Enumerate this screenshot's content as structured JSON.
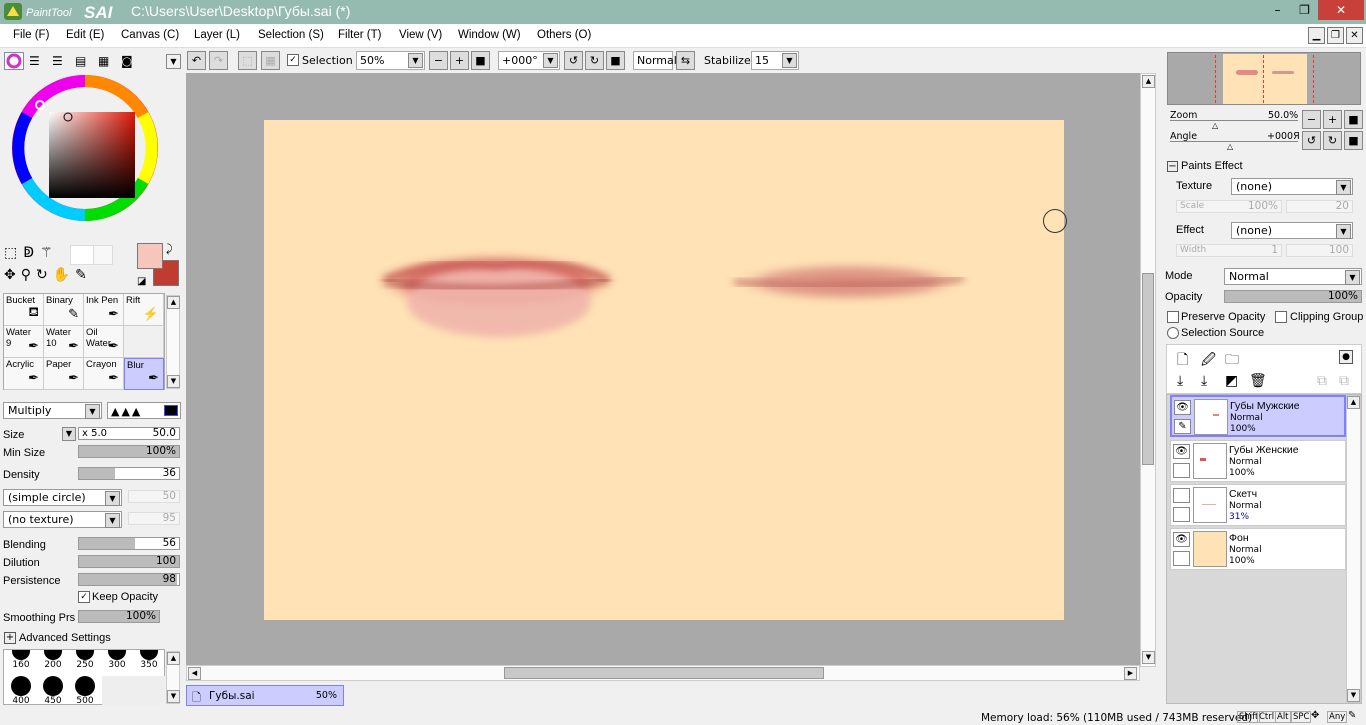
{
  "app": {
    "logo_text": "PaintTool SAI",
    "title": "C:\\Users\\User\\Desktop\\Губы.sai (*)"
  },
  "window": {
    "minimize": "–",
    "maximize": "❐",
    "close": "✕"
  },
  "menu": [
    "File (F)",
    "Edit (E)",
    "Canvas (C)",
    "Layer (L)",
    "Selection (S)",
    "Filter (T)",
    "View (V)",
    "Window (W)",
    "Others (O)"
  ],
  "toolbar": {
    "selection_label": "Selection",
    "selection_checked": true,
    "zoom": "50%",
    "angle": "+000°",
    "blend": "Normal",
    "stabilizer_label": "Stabilizer",
    "stabilizer": "15"
  },
  "tools": [
    {
      "name": "Bucket",
      "num": ""
    },
    {
      "name": "Binary",
      "num": ""
    },
    {
      "name": "Ink Pen",
      "num": ""
    },
    {
      "name": "Rift",
      "num": ""
    },
    {
      "name": "Water",
      "num": "9"
    },
    {
      "name": "Water",
      "num": "10"
    },
    {
      "name": "Oil Water",
      "num": ""
    },
    {
      "name": "",
      "num": ""
    },
    {
      "name": "Acrylic",
      "num": ""
    },
    {
      "name": "Paper",
      "num": ""
    },
    {
      "name": "Crayon",
      "num": ""
    },
    {
      "name": "Blur",
      "num": ""
    }
  ],
  "brush": {
    "mode": "Multiply",
    "size_label": "Size",
    "size_mult": "x 5.0",
    "size": "50.0",
    "min_size_label": "Min Size",
    "min_size": "100%",
    "min_size_frac": 1.0,
    "density_label": "Density",
    "density": "36",
    "density_frac": 0.36,
    "shape": "(simple circle)",
    "shape_val": "50",
    "texture": "(no texture)",
    "texture_val": "95",
    "blending_label": "Blending",
    "blending": "56",
    "blending_frac": 0.56,
    "dilution_label": "Dilution",
    "dilution": "100",
    "dilution_frac": 1.0,
    "persistence_label": "Persistence",
    "persistence": "98",
    "persistence_frac": 0.98,
    "keep_opacity_label": "Keep Opacity",
    "smoothing_label": "Smoothing Prs",
    "smoothing": "100%",
    "smoothing_frac": 1.0,
    "advanced_label": "Advanced Settings",
    "sizes": [
      "160",
      "200",
      "250",
      "300",
      "350",
      "400",
      "450",
      "500"
    ]
  },
  "navigator": {
    "zoom_label": "Zoom",
    "zoom": "50.0%",
    "angle_label": "Angle",
    "angle": "+000Я"
  },
  "paints_effect": {
    "header": "Paints Effect",
    "texture_label": "Texture",
    "texture": "(none)",
    "scale_label": "Scale",
    "scale": "100%",
    "scale2": "20",
    "effect_label": "Effect",
    "effect": "(none)",
    "width_label": "Width",
    "width": "1",
    "width2": "100"
  },
  "layer_props": {
    "mode_label": "Mode",
    "mode": "Normal",
    "opacity_label": "Opacity",
    "opacity": "100%",
    "preserve": "Preserve Opacity",
    "clipping": "Clipping Group",
    "selsource": "Selection Source"
  },
  "layers": [
    {
      "name": "Губы Мужские",
      "mode": "Normal",
      "opacity": "100%",
      "visible": true,
      "selected": true
    },
    {
      "name": "Губы Женские",
      "mode": "Normal",
      "opacity": "100%",
      "visible": true,
      "selected": false
    },
    {
      "name": "Скетч",
      "mode": "Normal",
      "opacity": "31%",
      "visible": false,
      "selected": false
    },
    {
      "name": "Фон",
      "mode": "Normal",
      "opacity": "100%",
      "visible": true,
      "selected": false
    }
  ],
  "doc_tab": {
    "name": "Губы.sai",
    "zoom": "50%"
  },
  "status": {
    "memory": "Memory load: 56% (110MB used / 743MB reserved)",
    "keys": [
      "Shift",
      "Ctrl",
      "Alt",
      "SPC",
      "Any"
    ]
  },
  "colors": {
    "titlebar": "#95bbb0",
    "canvas_bg": "#a9a9a9",
    "paper": "#ffe2b6",
    "primary": "#f4c6bc",
    "secondary": "#c03c30",
    "selected_layer": "#ccccff"
  }
}
